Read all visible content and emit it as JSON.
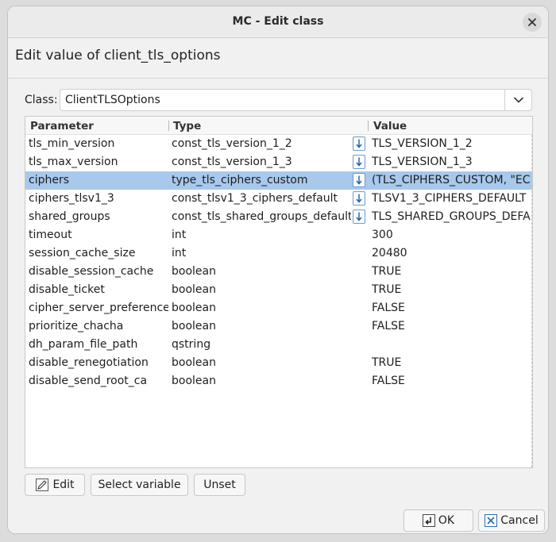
{
  "window": {
    "title": "MC - Edit class"
  },
  "heading": "Edit value of client_tls_options",
  "class_selector": {
    "label": "Class:",
    "value": "ClientTLSOptions"
  },
  "table": {
    "columns": [
      "Parameter",
      "Type",
      "Value"
    ],
    "rows": [
      {
        "parameter": "tls_min_version",
        "type": "const_tls_version_1_2",
        "value": "TLS_VERSION_1_2",
        "enum": true
      },
      {
        "parameter": "tls_max_version",
        "type": "const_tls_version_1_3",
        "value": "TLS_VERSION_1_3",
        "enum": true
      },
      {
        "parameter": "ciphers",
        "type": "type_tls_ciphers_custom",
        "value": "(TLS_CIPHERS_CUSTOM, \"ECDH",
        "enum": true,
        "selected": true
      },
      {
        "parameter": "ciphers_tlsv1_3",
        "type": "const_tlsv1_3_ciphers_default",
        "value": "TLSV1_3_CIPHERS_DEFAULT",
        "enum": true
      },
      {
        "parameter": "shared_groups",
        "type": "const_tls_shared_groups_default",
        "value": "TLS_SHARED_GROUPS_DEFAULT",
        "enum": true
      },
      {
        "parameter": "timeout",
        "type": "int",
        "value": "300"
      },
      {
        "parameter": "session_cache_size",
        "type": "int",
        "value": "20480"
      },
      {
        "parameter": "disable_session_cache",
        "type": "boolean",
        "value": "TRUE"
      },
      {
        "parameter": "disable_ticket",
        "type": "boolean",
        "value": "TRUE"
      },
      {
        "parameter": "cipher_server_preference",
        "type": "boolean",
        "value": "FALSE"
      },
      {
        "parameter": "prioritize_chacha",
        "type": "boolean",
        "value": "FALSE"
      },
      {
        "parameter": "dh_param_file_path",
        "type": "qstring",
        "value": ""
      },
      {
        "parameter": "disable_renegotiation",
        "type": "boolean",
        "value": "TRUE"
      },
      {
        "parameter": "disable_send_root_ca",
        "type": "boolean",
        "value": "FALSE"
      }
    ]
  },
  "actions": {
    "edit": "Edit",
    "select_variable": "Select variable",
    "unset": "Unset"
  },
  "footer": {
    "ok": "OK",
    "cancel": "Cancel"
  },
  "colors": {
    "selection": "#a8c8ec",
    "accent": "#2b6cb0"
  },
  "icons": {
    "close": "close-icon",
    "dropdown": "chevron-down-icon",
    "enum": "enum-select-icon",
    "edit": "pencil-icon",
    "ok": "ok-icon",
    "cancel": "cancel-icon"
  }
}
